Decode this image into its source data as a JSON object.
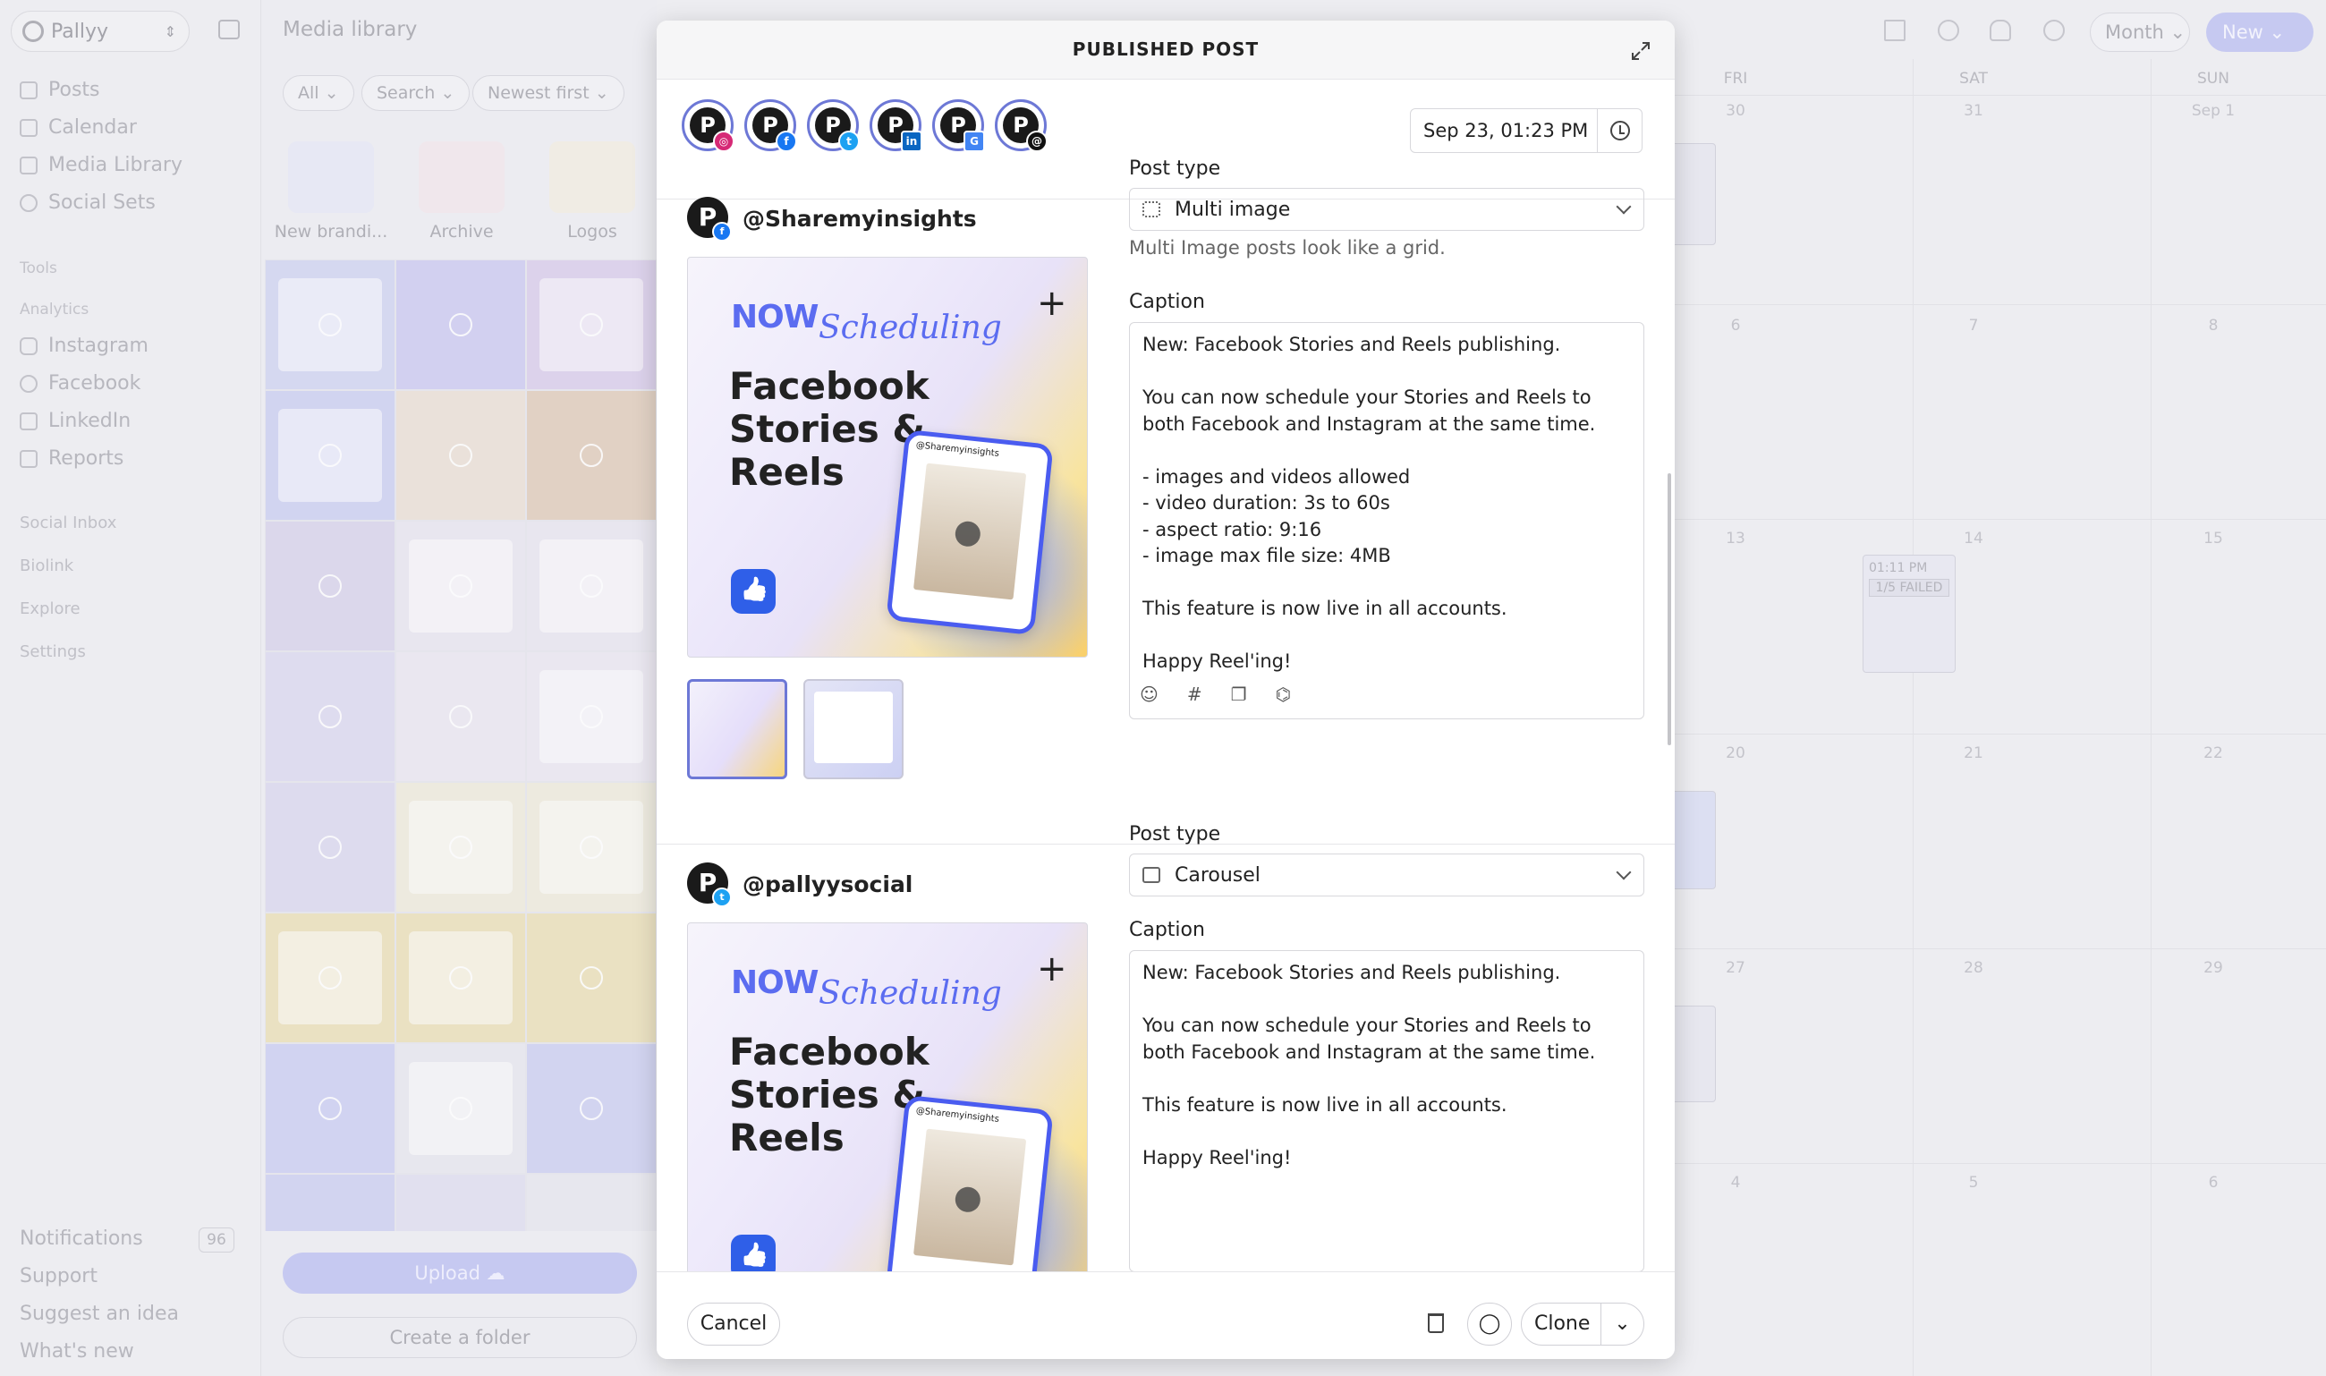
{
  "sidebar": {
    "brand": "Pallyy",
    "nav": [
      {
        "label": "Posts",
        "icon": "posts-icon"
      },
      {
        "label": "Calendar",
        "icon": "calendar-icon"
      },
      {
        "label": "Media Library",
        "icon": "image-icon"
      },
      {
        "label": "Social Sets",
        "icon": "gear-icon"
      }
    ],
    "tools_heading": "Tools",
    "analytics_heading": "Analytics",
    "analytics": [
      {
        "label": "Instagram",
        "icon": "instagram-icon"
      },
      {
        "label": "Facebook",
        "icon": "facebook-icon"
      },
      {
        "label": "LinkedIn",
        "icon": "linkedin-icon"
      },
      {
        "label": "Reports",
        "icon": "reports-icon"
      }
    ],
    "more": [
      "Social Inbox",
      "Biolink",
      "Explore",
      "Settings"
    ],
    "bottom": {
      "notifications": "Notifications",
      "notifications_count": "96",
      "support": "Support",
      "suggest": "Suggest an idea",
      "whats_new": "What's new"
    }
  },
  "media": {
    "title": "Media library",
    "filters": {
      "all": "All",
      "search": "Search",
      "sort": "Newest first"
    },
    "folders": [
      "New brandi...",
      "Archive",
      "Logos"
    ],
    "upload": "Upload",
    "create_folder": "Create a folder"
  },
  "calendar": {
    "view": "Month",
    "new": "New",
    "days": [
      "FRI",
      "SAT",
      "SUN"
    ],
    "weeks": [
      [
        "30",
        "31",
        "Sep 1"
      ],
      [
        "6",
        "7",
        "8"
      ],
      [
        "13",
        "14",
        "15"
      ],
      [
        "20",
        "21",
        "22"
      ],
      [
        "27",
        "28",
        "29"
      ],
      [
        "4",
        "5",
        "6"
      ]
    ],
    "event_time": "01:11 PM",
    "event_status": "1/5 FAILED"
  },
  "modal": {
    "title": "PUBLISHED POST",
    "accounts": [
      {
        "network": "instagram",
        "color": "#d62976"
      },
      {
        "network": "facebook",
        "color": "#1877f2"
      },
      {
        "network": "twitter",
        "color": "#1da1f2"
      },
      {
        "network": "linkedin",
        "color": "#0a66c2"
      },
      {
        "network": "google",
        "color": "#4285f4"
      },
      {
        "network": "threads",
        "color": "#111111"
      }
    ],
    "datetime": "Sep 23, 01:23 PM",
    "posts": [
      {
        "handle": "@Sharemyinsights",
        "network": "facebook",
        "post_type_label": "Post type",
        "post_type": "Multi image",
        "hint": "Multi Image posts look like a grid.",
        "caption_label": "Caption",
        "caption": "New: Facebook Stories and Reels publishing.\n\nYou can now schedule your Stories and Reels to both Facebook and Instagram at the same time.\n\n- images and videos allowed\n- video duration: 3s to 60s\n- aspect ratio: 9:16\n- image max file size: 4MB\n\nThis feature is now live in all accounts.\n\nHappy Reel'ing!"
      },
      {
        "handle": "@pallyysocial",
        "network": "twitter",
        "post_type_label": "Post type",
        "post_type": "Carousel",
        "caption_label": "Caption",
        "caption": "New: Facebook Stories and Reels publishing.\n\nYou can now schedule your Stories and Reels to both Facebook and Instagram at the same time.\n\nThis feature is now live in all accounts.\n\nHappy Reel'ing!"
      }
    ],
    "preview": {
      "now": "NOW",
      "scheduling": "Scheduling",
      "headline": "Facebook Stories & Reels",
      "phone_tag": "@Sharemyinsights"
    },
    "footer": {
      "cancel": "Cancel",
      "clone": "Clone"
    }
  }
}
